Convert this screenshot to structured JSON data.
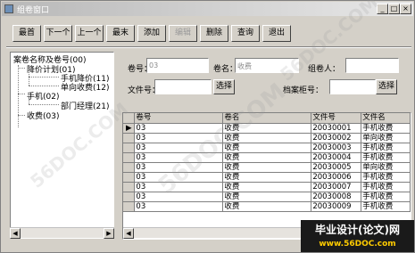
{
  "window": {
    "title": "组卷窗口",
    "controls": {
      "minimize": "_",
      "maximize": "□",
      "close": "×"
    }
  },
  "toolbar": {
    "buttons": [
      {
        "label": "最首",
        "enabled": true
      },
      {
        "label": "下一个",
        "enabled": true
      },
      {
        "label": "上一个",
        "enabled": true
      },
      {
        "label": "最末",
        "enabled": true
      },
      {
        "label": "添加",
        "enabled": true
      },
      {
        "label": "编辑",
        "enabled": false
      },
      {
        "label": "删除",
        "enabled": true
      },
      {
        "label": "查询",
        "enabled": true
      },
      {
        "label": "退出",
        "enabled": true
      }
    ]
  },
  "tree": {
    "root": "案卷名称及卷号(00)",
    "nodes": [
      {
        "label": "降价计划(01)"
      },
      {
        "label": "手机降价(11)"
      },
      {
        "label": "单向收费(12)"
      },
      {
        "label": "手机(02)"
      },
      {
        "label": "部门经理(21)"
      },
      {
        "label": "收费(03)"
      }
    ]
  },
  "form": {
    "volume_no_label": "卷号：",
    "volume_no_value": "03",
    "volume_name_label": "卷名：",
    "volume_name_value": "收费",
    "composer_label": "组卷人：",
    "composer_value": "",
    "file_no_label": "文件号：",
    "file_no_value": "",
    "choose_label": "选择",
    "archive_no_label": "档案柜号：",
    "archive_no_value": ""
  },
  "grid": {
    "columns": [
      "卷号",
      "卷名",
      "文件号",
      "文件名"
    ],
    "rows": [
      [
        "03",
        "收费",
        "20030001",
        "手机收费"
      ],
      [
        "03",
        "收费",
        "20030002",
        "单向收费"
      ],
      [
        "03",
        "收费",
        "20030003",
        "手机收费"
      ],
      [
        "03",
        "收费",
        "20030004",
        "手机收费"
      ],
      [
        "03",
        "收费",
        "20030005",
        "单向收费"
      ],
      [
        "03",
        "收费",
        "20030006",
        "手机收费"
      ],
      [
        "03",
        "收费",
        "20030007",
        "手机收费"
      ],
      [
        "03",
        "收费",
        "20030008",
        "手机收费"
      ],
      [
        "03",
        "收费",
        "20030009",
        "手机收费"
      ]
    ],
    "current_row_marker": "▶"
  },
  "scroll": {
    "left_arrow": "◀",
    "right_arrow": "▶"
  },
  "banner": {
    "line1": "毕业设计(论文)网",
    "line2": "www.56DOC.com"
  },
  "watermark": "56DOC.COM"
}
